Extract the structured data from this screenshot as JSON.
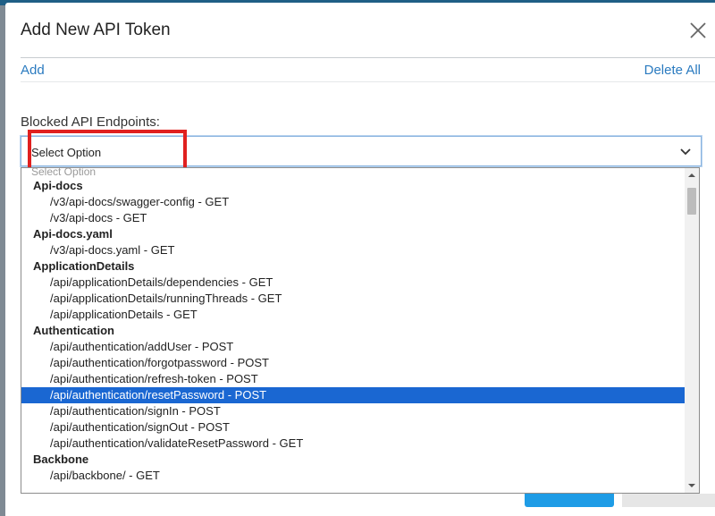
{
  "modal": {
    "title": "Add New API Token",
    "add_label": "Add",
    "delete_all_label": "Delete All",
    "field_label": "Blocked API Endpoints:",
    "select_value": "Select Option"
  },
  "dropdown": {
    "placeholder": "Select Option",
    "groups": [
      {
        "label": "Api-docs",
        "items": [
          "/v3/api-docs/swagger-config - GET",
          "/v3/api-docs - GET"
        ]
      },
      {
        "label": "Api-docs.yaml",
        "items": [
          "/v3/api-docs.yaml - GET"
        ]
      },
      {
        "label": "ApplicationDetails",
        "items": [
          "/api/applicationDetails/dependencies - GET",
          "/api/applicationDetails/runningThreads - GET",
          "/api/applicationDetails - GET"
        ]
      },
      {
        "label": "Authentication",
        "items": [
          "/api/authentication/addUser - POST",
          "/api/authentication/forgotpassword - POST",
          "/api/authentication/refresh-token - POST",
          "/api/authentication/resetPassword - POST",
          "/api/authentication/signIn - POST",
          "/api/authentication/signOut - POST",
          "/api/authentication/validateResetPassword - GET"
        ]
      },
      {
        "label": "Backbone",
        "items": [
          "/api/backbone/ - GET"
        ]
      }
    ],
    "selected_item": "/api/authentication/resetPassword - POST"
  },
  "colors": {
    "accent": "#2b7bc0",
    "selected_bg": "#1a67d2",
    "highlight_border": "#e0201f"
  },
  "icons": {
    "close": "close-icon",
    "chevron": "chevron-down-icon",
    "scroll_up": "scroll-up-arrow-icon",
    "scroll_down": "scroll-down-arrow-icon"
  }
}
